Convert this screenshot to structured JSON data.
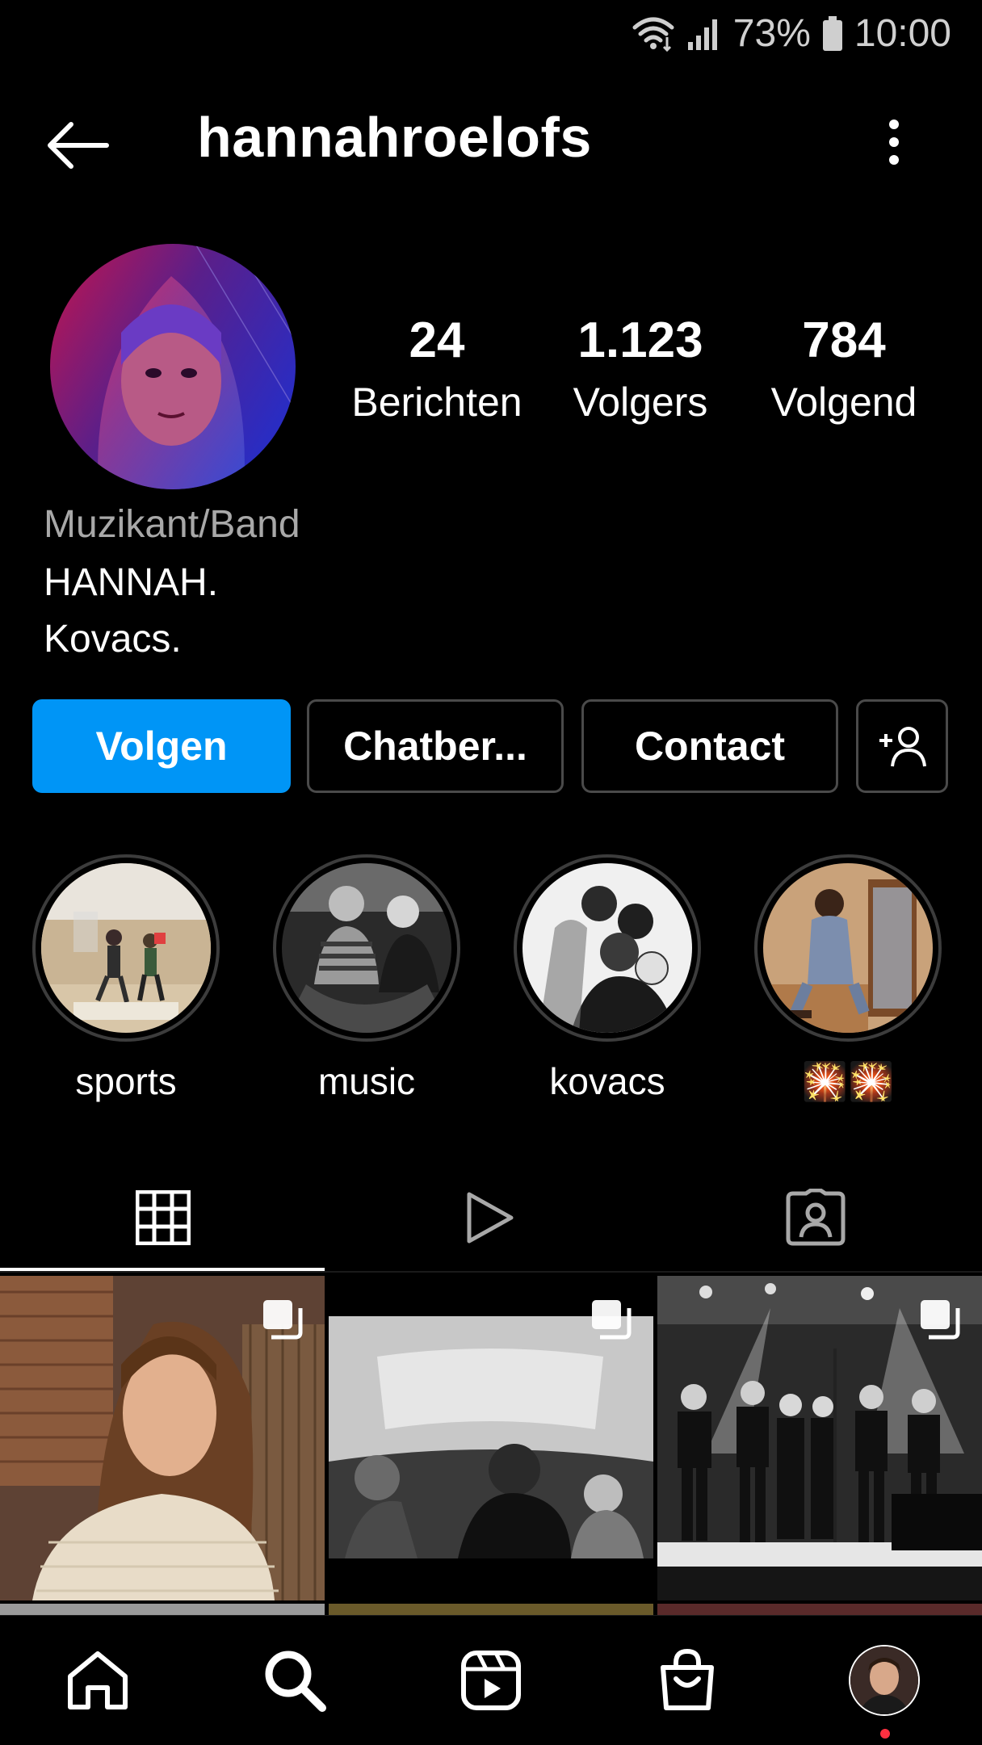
{
  "status_bar": {
    "battery": "73%",
    "time": "10:00"
  },
  "header": {
    "username": "hannahroelofs"
  },
  "profile": {
    "stats": [
      {
        "value": "24",
        "label": "Berichten"
      },
      {
        "value": "1.123",
        "label": "Volgers"
      },
      {
        "value": "784",
        "label": "Volgend"
      }
    ],
    "category": "Muzikant/Band",
    "bio_line1": "HANNAH.",
    "bio_line2": "Kovacs."
  },
  "actions": {
    "follow": "Volgen",
    "message": "Chatber...",
    "contact": "Contact"
  },
  "highlights": [
    {
      "name": "sports"
    },
    {
      "name": "music"
    },
    {
      "name": "kovacs"
    },
    {
      "name": "🎇🎇"
    }
  ],
  "colors": {
    "accent": "#0095f6",
    "background": "#000000",
    "secondary_text": "#a8a8a8"
  }
}
